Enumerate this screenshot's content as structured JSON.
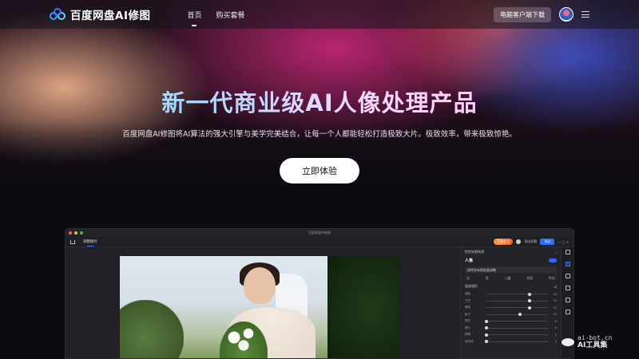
{
  "nav": {
    "brand": "百度网盘AI修图",
    "links": [
      {
        "label": "首页",
        "active": true
      },
      {
        "label": "购买套餐",
        "active": false
      }
    ],
    "download_label": "电脑客户端下载"
  },
  "hero": {
    "title": "新一代商业级AI人像处理产品",
    "subtitle": "百度网盘AI修图将AI算法的强大引擎与美学完美结合，让每一个人都能轻松打造极致大片。极致效率，带来极致惊艳。",
    "cta_label": "立即体验"
  },
  "app": {
    "window_title": "百度网盘AI修图",
    "tab_label": "调整图片",
    "vip_label": "开通会员",
    "export_list_label": "导出列表",
    "export_label": "导出",
    "panel": {
      "header": "性别年龄修改",
      "section_title": "人像",
      "select_label": "按性别年龄批量调整",
      "tabs": [
        "全",
        "男",
        "儿童",
        "年龄",
        "性别"
      ],
      "group_label": "面部塑形",
      "sliders": [
        {
          "label": "瘦脸",
          "value": "50",
          "level": 0.7
        },
        {
          "label": "下巴",
          "value": "50",
          "level": 0.7
        },
        {
          "label": "眼睛",
          "value": "50",
          "level": 0.7
        },
        {
          "label": "鼻子",
          "value": "30",
          "level": 0.55
        },
        {
          "label": "嘴巴",
          "value": "0",
          "level": 0.0
        },
        {
          "label": "额头",
          "value": "0",
          "level": 0.0
        },
        {
          "label": "颧骨",
          "value": "0",
          "level": 0.0
        },
        {
          "label": "发际线",
          "value": "0",
          "level": 0.0
        }
      ]
    }
  },
  "watermark": {
    "site": "ai-bot.cn",
    "name": "AI工具集"
  },
  "colors": {
    "accent": "#2f6bff",
    "title_gradient_start": "#6ee0ff",
    "title_gradient_end": "#ffb0e8"
  }
}
